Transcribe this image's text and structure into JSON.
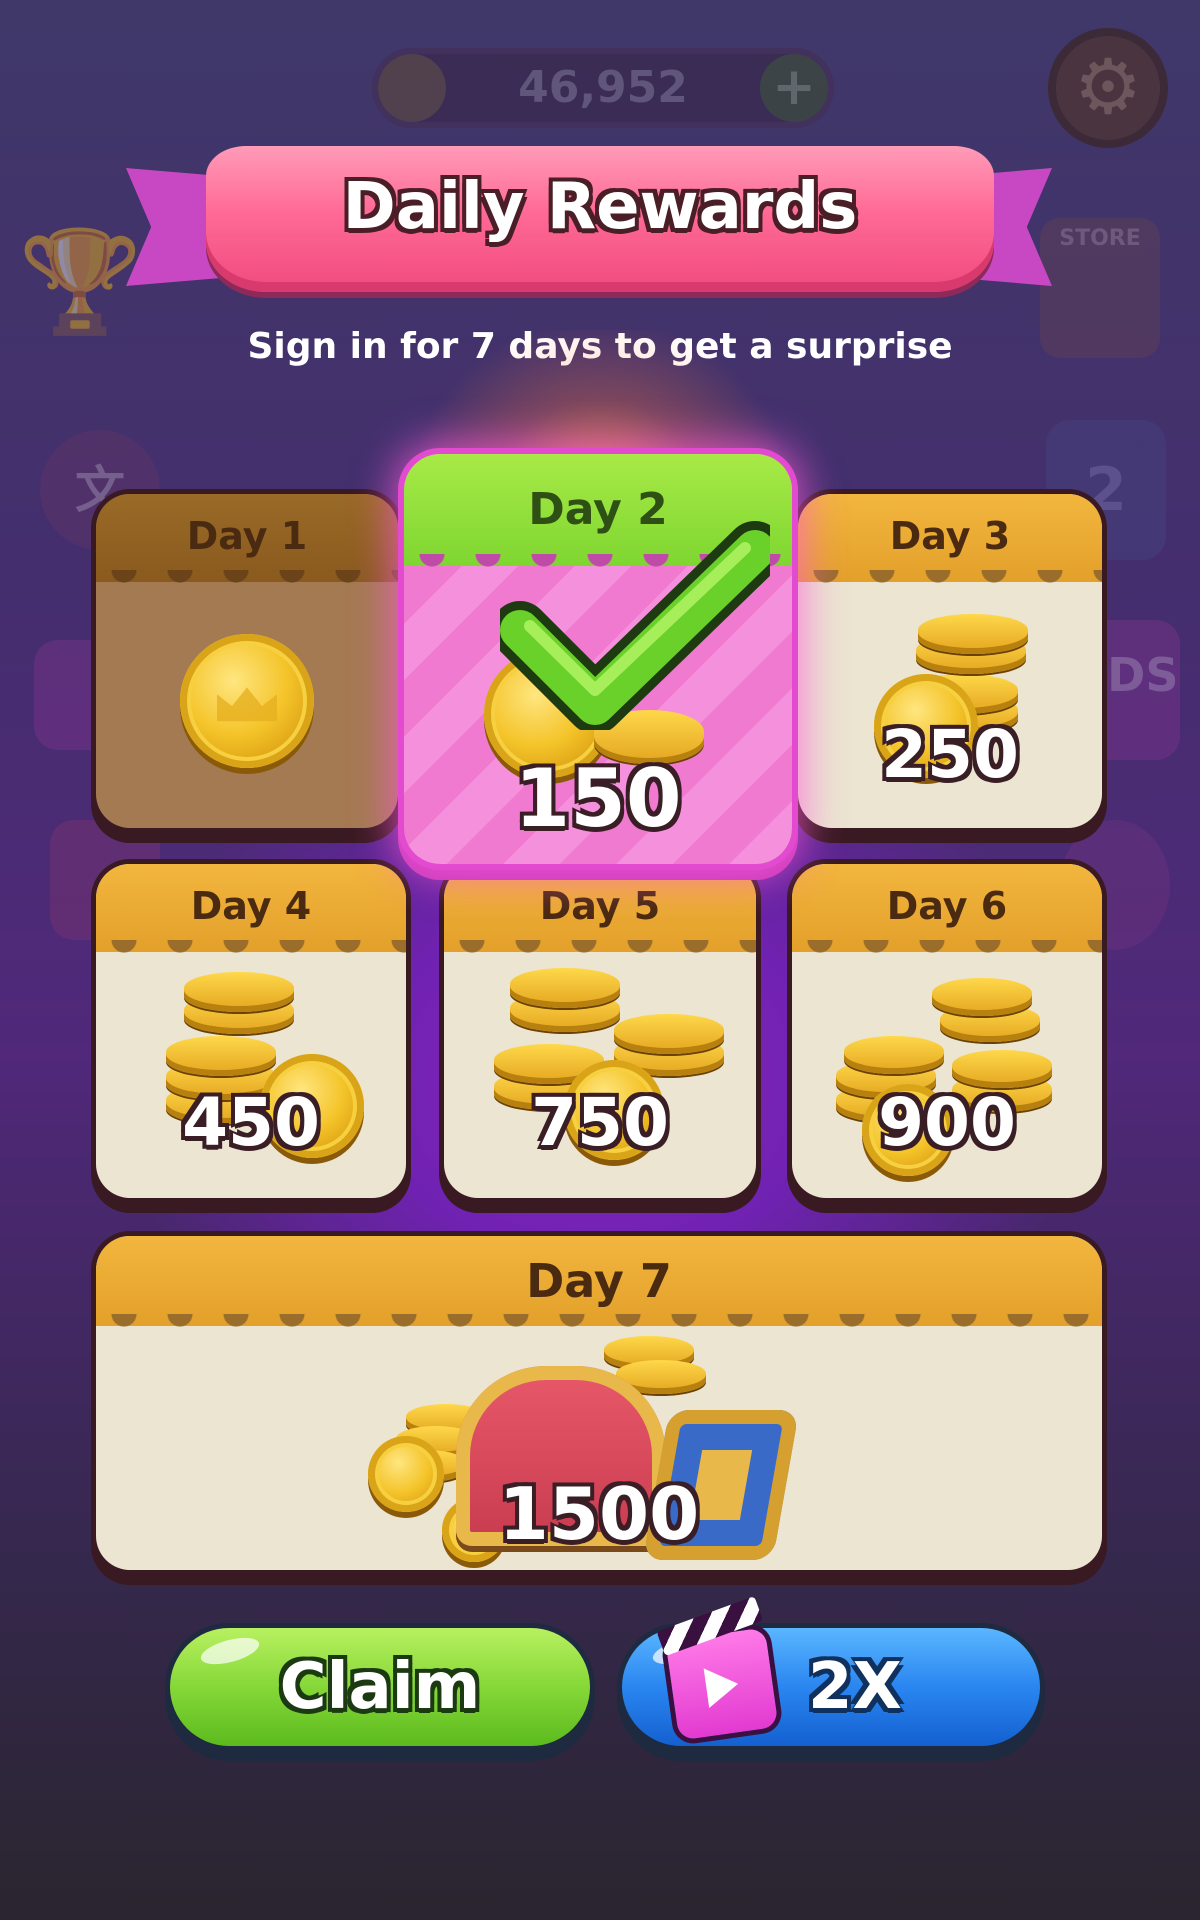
{
  "hud": {
    "coin_balance": "46,952",
    "coin_icon": "coin-icon",
    "add_icon": "plus-icon",
    "settings_icon": "gear-icon"
  },
  "side_icons": {
    "left": [
      "trophy-icon",
      "translate-icon",
      "gift-icon",
      "photo-icon"
    ],
    "right": [
      "store-icon",
      "calendar-icon",
      "no-ads-icon",
      "palette-icon"
    ],
    "store_label": "STORE",
    "calendar_number": "2",
    "ads_label": "ADS"
  },
  "title": "Daily Rewards",
  "subtitle": "Sign in for 7 days to get a surprise",
  "days": [
    {
      "label": "Day 1",
      "amount": "",
      "state": "claimed"
    },
    {
      "label": "Day 2",
      "amount": "150",
      "state": "today-claimed"
    },
    {
      "label": "Day 3",
      "amount": "250",
      "state": "locked"
    },
    {
      "label": "Day 4",
      "amount": "450",
      "state": "locked"
    },
    {
      "label": "Day 5",
      "amount": "750",
      "state": "locked"
    },
    {
      "label": "Day 6",
      "amount": "900",
      "state": "locked"
    },
    {
      "label": "Day 7",
      "amount": "1500",
      "state": "locked"
    }
  ],
  "buttons": {
    "claim": "Claim",
    "double": "2X",
    "double_icon": "video-clapper-icon"
  },
  "colors": {
    "banner": "#f04a7e",
    "today_header": "#7fd630",
    "today_body": "#f07ad0",
    "card_header": "#e3a02a",
    "claim_button": "#86d838",
    "double_button": "#2a86f0"
  }
}
